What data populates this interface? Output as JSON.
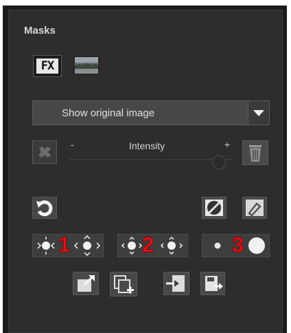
{
  "panel": {
    "title": "Masks"
  },
  "mode_buttons": {
    "fx_label": "FX"
  },
  "dropdown": {
    "selected": "Show original image"
  },
  "slider": {
    "label": "Intensity",
    "minus": "-",
    "plus": "+",
    "value": 0.92
  },
  "groups": [
    {
      "number": "1"
    },
    {
      "number": "2"
    },
    {
      "number": "3"
    }
  ],
  "icons": [
    "fx-icon",
    "landscape-icon",
    "chevron-down-icon",
    "clear-mask-icon",
    "trash-icon",
    "undo-icon",
    "invert-mask-icon",
    "brush-icon",
    "shrink-mask-icon",
    "expand-mask-icon",
    "smooth-less-icon",
    "smooth-more-icon",
    "small-dot-icon",
    "large-dot-icon",
    "export-icon",
    "copy-add-icon",
    "import-icon",
    "save-icon"
  ],
  "colors": {
    "panel_bg": "#2d2d2d",
    "accent_number": "#e2141b"
  }
}
